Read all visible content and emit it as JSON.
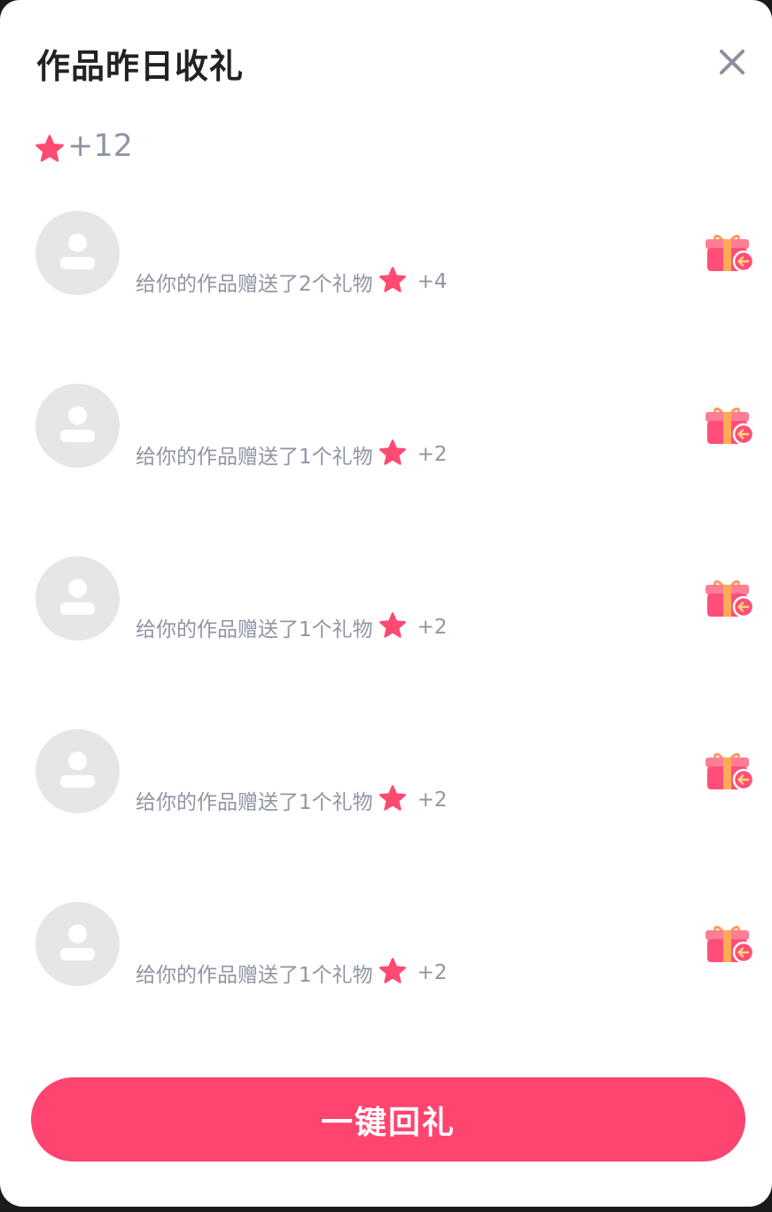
{
  "header": {
    "title": "作品昨日收礼",
    "close_icon": "close-icon"
  },
  "summary": {
    "star_icon": "star-icon",
    "total": "+12"
  },
  "colors": {
    "accent": "#ff446f",
    "star": "#ff4a72",
    "muted_text": "#8f95a3",
    "title_text": "#222222",
    "avatar_bg": "#e6e6e6"
  },
  "gifts": [
    {
      "description": "给你的作品赠送了2个礼物",
      "amount": "+4"
    },
    {
      "description": "给你的作品赠送了1个礼物",
      "amount": "+2"
    },
    {
      "description": "给你的作品赠送了1个礼物",
      "amount": "+2"
    },
    {
      "description": "给你的作品赠送了1个礼物",
      "amount": "+2"
    },
    {
      "description": "给你的作品赠送了1个礼物",
      "amount": "+2"
    }
  ],
  "footer": {
    "return_all_label": "一键回礼"
  }
}
